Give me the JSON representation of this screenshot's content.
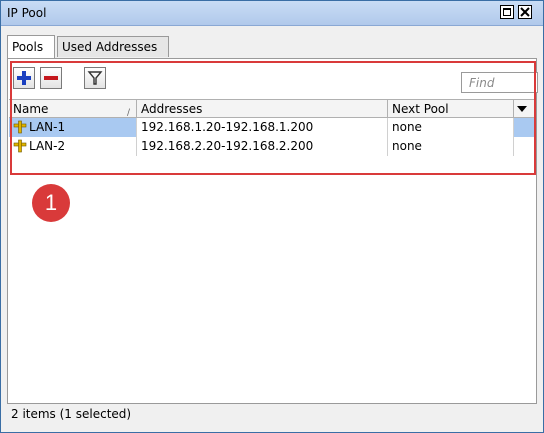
{
  "window": {
    "title": "IP Pool"
  },
  "tabs": [
    {
      "label": "Pools",
      "active": true
    },
    {
      "label": "Used Addresses",
      "active": false
    }
  ],
  "toolbar": {
    "add_icon": "plus-icon",
    "remove_icon": "minus-icon",
    "filter_icon": "filter-icon",
    "find_placeholder": "Find"
  },
  "table": {
    "columns": [
      "Name",
      "Addresses",
      "Next Pool"
    ],
    "rows": [
      {
        "name": "LAN-1",
        "addresses": "192.168.1.20-192.168.1.200",
        "next_pool": "none",
        "selected": true
      },
      {
        "name": "LAN-2",
        "addresses": "192.168.2.20-192.168.2.200",
        "next_pool": "none",
        "selected": false
      }
    ]
  },
  "annotation": {
    "marker_number": "1",
    "color": "#d93a3a"
  },
  "status": {
    "text": "2 items (1 selected)"
  }
}
